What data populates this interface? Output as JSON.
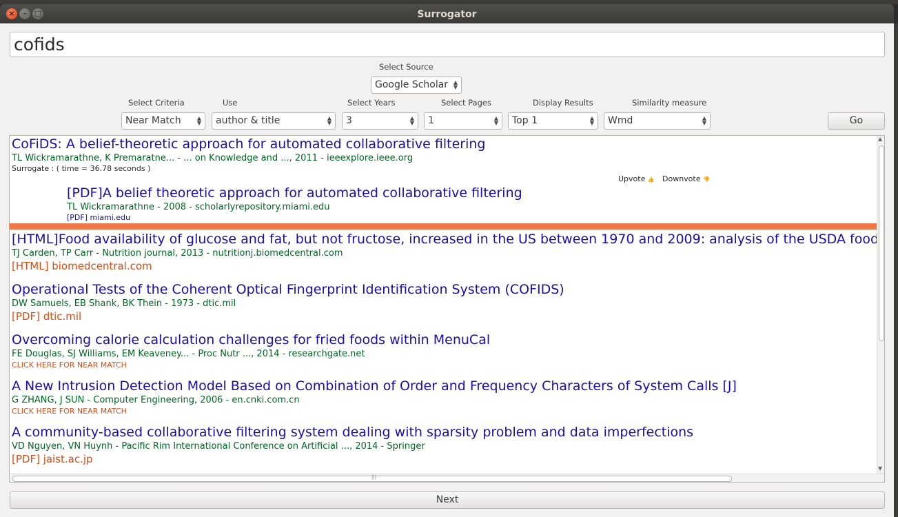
{
  "window": {
    "title": "Surrogator"
  },
  "search": {
    "value": "cofids"
  },
  "source": {
    "label": "Select Source",
    "value": "Google Scholar"
  },
  "filters": [
    {
      "label": "Select Criteria",
      "value": "Near Match"
    },
    {
      "label": "Use",
      "value": "author & title"
    },
    {
      "label": "Select Years",
      "value": "3"
    },
    {
      "label": "Select Pages",
      "value": "1"
    },
    {
      "label": "Display Results",
      "value": "Top 1"
    },
    {
      "label": "Similarity measure",
      "value": "Wmd"
    }
  ],
  "go_label": "Go",
  "surrogate": {
    "title": "CoFiDS: A belief-theoretic approach for automated collaborative filtering",
    "meta": "TL Wickramarathne, K Premaratne... - ... on Knowledge and ..., 2011 - ieeexplore.ieee.org",
    "info": "Surrogate :   ( time = 36.78 seconds )",
    "upvote": "Upvote",
    "downvote": "Downvote",
    "match_title": "[PDF]A belief theoretic approach for automated collaborative filtering",
    "match_meta": "TL Wickramarathne - 2008 - scholarlyrepository.miami.edu",
    "match_link": "[PDF] miami.edu"
  },
  "results": [
    {
      "title": "[HTML]Food availability of glucose and fat, but not fructose, increased in the US between 1970 and 2009: analysis of the USDA food",
      "meta": "TJ Carden, TP Carr - Nutrition journal, 2013 - nutritionj.biomedcentral.com",
      "link": "[HTML] biomedcentral.com"
    },
    {
      "title": "Operational Tests of the Coherent Optical Fingerprint Identification System (COFIDS)",
      "meta": "DW Samuels, EB Shank, BK Thein - 1973 - dtic.mil",
      "link": "[PDF] dtic.mil"
    },
    {
      "title": "Overcoming calorie calculation challenges for fried foods within MenuCal",
      "meta": "FE Douglas, SJ Williams, EM Keaveney... - Proc Nutr ..., 2014 - researchgate.net",
      "near": "CLICK HERE FOR NEAR MATCH"
    },
    {
      "title": "A New Intrusion Detection Model Based on Combination of Order and Frequency Characters of System Calls [J]",
      "meta": "G ZHANG, J SUN - Computer Engineering, 2006 - en.cnki.com.cn",
      "near": "CLICK HERE FOR NEAR MATCH"
    },
    {
      "title": "A community-based collaborative filtering system dealing with sparsity problem and data imperfections",
      "meta": "VD Nguyen, VN Huynh - Pacific Rim International Conference on Artificial ..., 2014 - Springer",
      "link": "[PDF] jaist.ac.jp"
    }
  ],
  "next_label": "Next",
  "colors": {
    "accent_bar": "#f07746",
    "title_link": "#1a0dab",
    "meta_green": "#006621",
    "link_orange": "#dd4b12"
  },
  "icons": {
    "close": "close-icon",
    "minimize": "minimize-icon",
    "maximize": "maximize-icon"
  }
}
